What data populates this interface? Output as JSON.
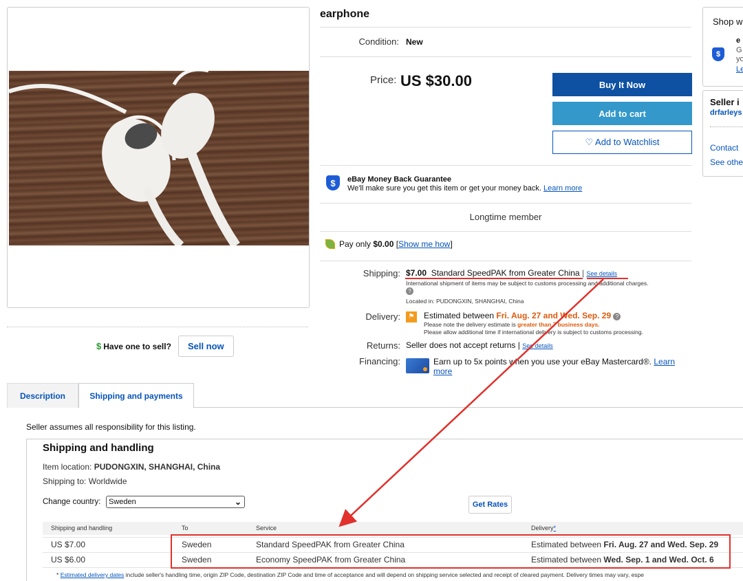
{
  "item": {
    "title": "earphone",
    "condition_label": "Condition:",
    "condition_value": "New",
    "price_label": "Price:",
    "price_value": "US $30.00"
  },
  "buttons": {
    "buy_now": "Buy It Now",
    "add_to_cart": "Add to cart",
    "watchlist": "♡ Add to Watchlist",
    "sell_question": "Have one to sell?",
    "sell_now": "Sell now",
    "get_rates": "Get Rates"
  },
  "guarantee": {
    "title": "eBay Money Back Guarantee",
    "text": "We'll make sure you get this item or get your money back.",
    "link": "Learn more"
  },
  "member": "Longtime member",
  "pay": {
    "prefix": "Pay only",
    "amount": "$0.00",
    "link": "Show me how"
  },
  "shipping": {
    "label": "Shipping:",
    "cost": "$7.00",
    "service": "Standard SpeedPAK from Greater China",
    "see_details": "See details",
    "note": "International shipment of items may be subject to customs processing and additional charges.",
    "location": "Located in: PUDONGXIN, SHANGHAI, China"
  },
  "delivery": {
    "label": "Delivery:",
    "prefix": "Estimated between",
    "range": "Fri. Aug. 27 and Wed. Sep. 29",
    "note1_prefix": "Please note the delivery estimate is",
    "note1_emph": "greater than 7 business days.",
    "note2": "Please allow additional time if international delivery is subject to customs processing."
  },
  "returns": {
    "label": "Returns:",
    "text": "Seller does not accept returns |",
    "link": "See details"
  },
  "financing": {
    "label": "Financing:",
    "text": "Earn up to 5x points when you use your eBay Mastercard®.",
    "link": "Learn more"
  },
  "right": {
    "shop_title": "Shop w",
    "shop_line1": "e",
    "shop_line2": "G",
    "shop_line3": "yo",
    "shop_link": "Le",
    "seller_title": "Seller i",
    "seller_name": "drfarleys",
    "contact": "Contact",
    "see_other": "See othe"
  },
  "tabs": {
    "description": "Description",
    "shipping": "Shipping and payments"
  },
  "section": {
    "assume": "Seller assumes all responsibility for this listing.",
    "title": "Shipping and handling",
    "item_location_label": "Item location:",
    "item_location": "PUDONGXIN, SHANGHAI, China",
    "shipping_to": "Shipping to: Worldwide",
    "change_country_label": "Change country:",
    "selected_country": "Sweden"
  },
  "table": {
    "headers": [
      "Shipping and handling",
      "To",
      "Service",
      "Delivery"
    ],
    "delivery_asterisk": "*",
    "rows": [
      {
        "cost": "US $7.00",
        "to": "Sweden",
        "service": "Standard SpeedPAK from Greater China",
        "delivery_prefix": "Estimated between",
        "delivery_range": "Fri. Aug. 27 and Wed. Sep. 29"
      },
      {
        "cost": "US $6.00",
        "to": "Sweden",
        "service": "Economy SpeedPAK from Greater China",
        "delivery_prefix": "Estimated between",
        "delivery_range": "Wed. Sep. 1 and Wed. Oct. 6"
      }
    ],
    "footnote_star": "*",
    "footnote_link": "Estimated delivery dates",
    "footnote_text": "include seller's handling time, origin ZIP Code, destination ZIP Code and time of acceptance and will depend on shipping service selected and receipt of cleared payment. Delivery times may vary, espe"
  },
  "icons": {
    "shield": "$",
    "dollar": "$",
    "help": "?",
    "flag": "⚑",
    "chevron": "⌄"
  },
  "colors": {
    "primary_blue": "#0e50a2",
    "cart_blue": "#3498ca",
    "link": "#0654ba",
    "annotation_red": "#e0312c",
    "delivery_orange": "#dd5a0c"
  }
}
